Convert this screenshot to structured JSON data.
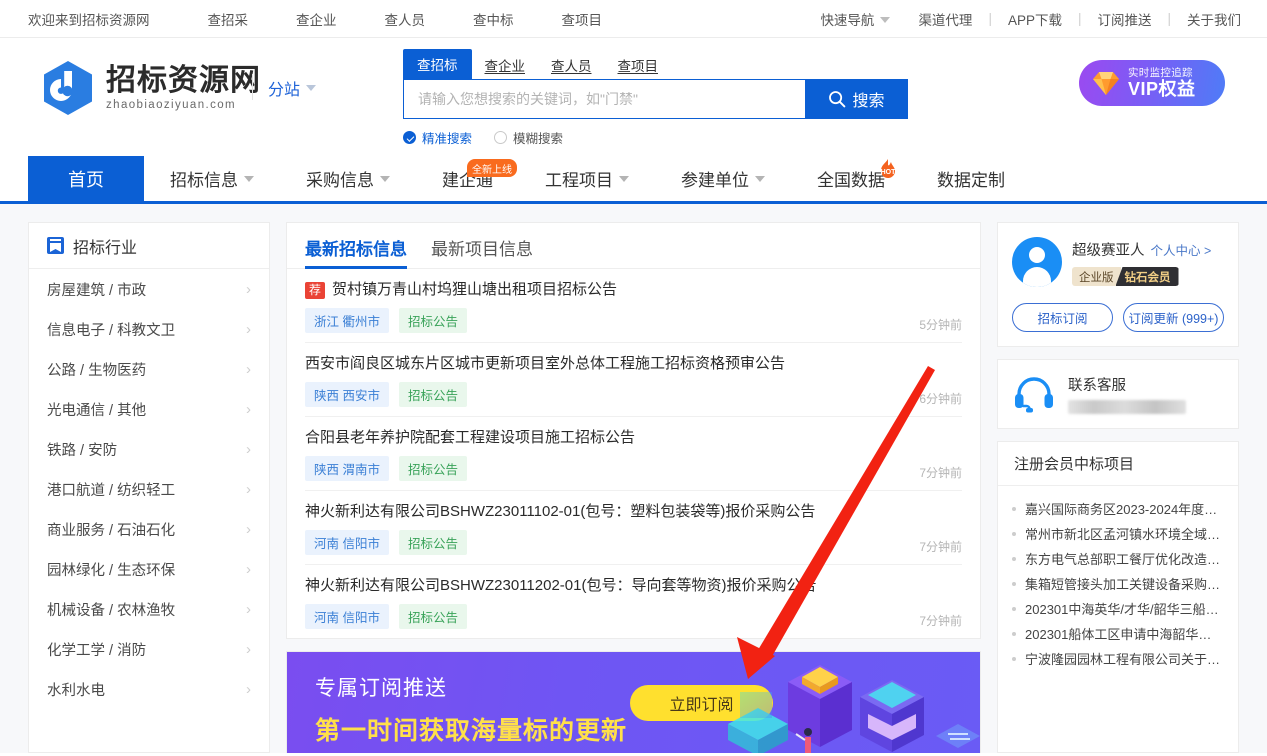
{
  "topbar": {
    "welcome": "欢迎来到招标资源网",
    "left_links": [
      "查招采",
      "查企业",
      "查人员",
      "查中标",
      "查项目"
    ],
    "quick_nav": "快速导航",
    "right_links": [
      "渠道代理",
      "APP下载",
      "订阅推送",
      "关于我们"
    ],
    "separator": "|"
  },
  "header": {
    "logo_cn": "招标资源网",
    "logo_en": "zhaobiaoziyuan.com",
    "subsite": "分站",
    "vip": {
      "sub": "实时监控追踪",
      "main": "VIP权益"
    }
  },
  "search": {
    "tabs": [
      {
        "label": "查招标",
        "active": true
      },
      {
        "label": "查企业",
        "active": false
      },
      {
        "label": "查人员",
        "active": false
      },
      {
        "label": "查项目",
        "active": false
      }
    ],
    "placeholder": "请输入您想搜索的关键词，如\"门禁\"",
    "value": "",
    "button": "搜索",
    "modes": [
      {
        "label": "精准搜索",
        "checked": true
      },
      {
        "label": "模糊搜索",
        "checked": false
      }
    ]
  },
  "mainnav": [
    {
      "label": "首页",
      "active": true,
      "caret": false,
      "badge": ""
    },
    {
      "label": "招标信息",
      "active": false,
      "caret": true,
      "badge": ""
    },
    {
      "label": "采购信息",
      "active": false,
      "caret": true,
      "badge": ""
    },
    {
      "label": "建企通",
      "active": false,
      "caret": false,
      "badge": "全新上线"
    },
    {
      "label": "工程项目",
      "active": false,
      "caret": true,
      "badge": ""
    },
    {
      "label": "参建单位",
      "active": false,
      "caret": true,
      "badge": ""
    },
    {
      "label": "全国数据",
      "active": false,
      "caret": false,
      "badge": "HOT"
    },
    {
      "label": "数据定制",
      "active": false,
      "caret": false,
      "badge": ""
    }
  ],
  "sidebar": {
    "title": "招标行业",
    "items": [
      "房屋建筑 / 市政",
      "信息电子 / 科教文卫",
      "公路 / 生物医药",
      "光电通信 / 其他",
      "铁路 / 安防",
      "港口航道 / 纺织轻工",
      "商业服务 / 石油石化",
      "园林绿化 / 生态环保",
      "机械设备 / 农林渔牧",
      "化学工学 / 消防",
      "水利水电"
    ],
    "arrow": "›"
  },
  "main": {
    "tabs": [
      {
        "label": "最新招标信息",
        "active": true
      },
      {
        "label": "最新项目信息",
        "active": false
      }
    ],
    "items": [
      {
        "rec": "荐",
        "title": "贺村镇万青山村坞狸山塘出租项目招标公告",
        "region": "浙江 衢州市",
        "type": "招标公告",
        "time": "5分钟前"
      },
      {
        "rec": "",
        "title": "西安市阎良区城东片区城市更新项目室外总体工程施工招标资格预审公告",
        "region": "陕西 西安市",
        "type": "招标公告",
        "time": "6分钟前"
      },
      {
        "rec": "",
        "title": "合阳县老年养护院配套工程建设项目施工招标公告",
        "region": "陕西 渭南市",
        "type": "招标公告",
        "time": "7分钟前"
      },
      {
        "rec": "",
        "title": "神火新利达有限公司BSHWZ23011102-01(包号：塑料包装袋等)报价采购公告",
        "region": "河南 信阳市",
        "type": "招标公告",
        "time": "7分钟前"
      },
      {
        "rec": "",
        "title": "神火新利达有限公司BSHWZ23011202-01(包号：导向套等物资)报价采购公告",
        "region": "河南 信阳市",
        "type": "招标公告",
        "time": "7分钟前"
      }
    ]
  },
  "promo": {
    "line1": "专属订阅推送",
    "line2": "第一时间获取海量标的更新",
    "button": "立即订阅"
  },
  "user": {
    "name": "超级赛亚人",
    "center_link": "个人中心 >",
    "badge_left": "企业版",
    "badge_right": "钻石会员",
    "btn_subscribe": "招标订阅",
    "btn_updates": "订阅更新 (999+)"
  },
  "service": {
    "title": "联系客服",
    "phone": ""
  },
  "member_projects": {
    "title": "注册会员中标项目",
    "items": [
      "嘉兴国际商务区2023-2024年度…",
      "常州市新北区孟河镇水环境全域…",
      "东方电气总部职工餐厅优化改造…",
      "集箱短管接头加工关键设备采购…",
      "202301中海英华/才华/韶华三船…",
      "202301船体工区申请中海韶华…",
      "宁波隆园园林工程有限公司关于…"
    ]
  },
  "colors": {
    "brand_blue": "#0b5fd4",
    "accent_red": "#ea4335",
    "tag_green": "#3aa35a",
    "promo_yellow": "#ffe02e",
    "annotation_red": "#f22212"
  }
}
